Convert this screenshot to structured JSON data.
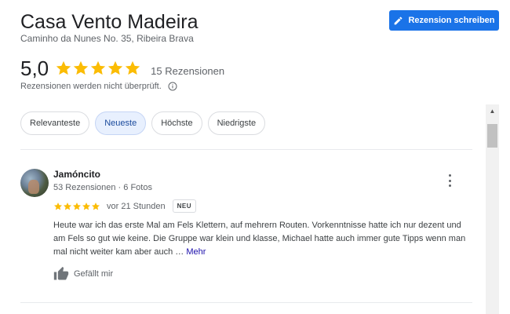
{
  "place": {
    "name": "Casa Vento Madeira",
    "address": "Caminho da Nunes No. 35, Ribeira Brava"
  },
  "write_review_button": {
    "label": "Rezension schreiben",
    "icon": "pencil-icon",
    "color": "#1a73e8"
  },
  "summary": {
    "rating": "5,0",
    "stars": 5,
    "review_count": "15 Rezensionen",
    "notice": "Rezensionen werden nicht überprüft.",
    "star_color": "#fbbc04"
  },
  "sort_chips": [
    {
      "label": "Relevanteste",
      "active": false
    },
    {
      "label": "Neueste",
      "active": true
    },
    {
      "label": "Höchste",
      "active": false
    },
    {
      "label": "Niedrigste",
      "active": false
    }
  ],
  "reviews": [
    {
      "author": "Jamóncito",
      "meta": "53 Rezensionen · 6 Fotos",
      "stars": 5,
      "date": "vor 21 Stunden",
      "badge": "NEU",
      "text": "Heute war ich das erste Mal am Fels Klettern, auf mehrern Routen. Vorkenntnisse hatte ich nur dezent und am Fels so gut wie keine. Die Gruppe war klein und klasse, Michael hatte auch immer gute Tipps wenn man mal nicht weiter kam aber auch …",
      "more_label": "Mehr",
      "like_label": "Gefällt mir"
    }
  ]
}
